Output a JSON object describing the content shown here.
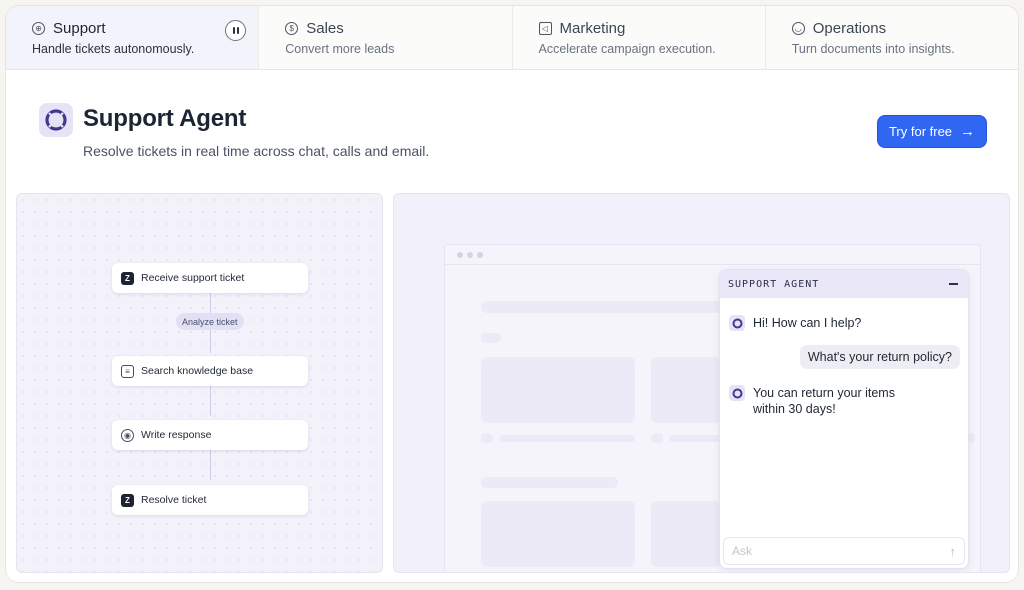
{
  "tabs": [
    {
      "label": "Support",
      "description": "Handle tickets autonomously.",
      "icon": "lifebuoy-icon",
      "active": true
    },
    {
      "label": "Sales",
      "description": "Convert more leads",
      "icon": "dollar-icon",
      "active": false
    },
    {
      "label": "Marketing",
      "description": "Accelerate campaign execution.",
      "icon": "megaphone-icon",
      "active": false
    },
    {
      "label": "Operations",
      "description": "Turn documents into insights.",
      "icon": "smiley-icon",
      "active": false
    }
  ],
  "header": {
    "title": "Support Agent",
    "subtitle": "Resolve tickets in real time across chat, calls and email.",
    "cta_label": "Try for free",
    "accent": "#2f66f2"
  },
  "workflow": {
    "steps": [
      {
        "label": "Receive support ticket",
        "icon": "zendesk-icon"
      },
      {
        "label": "Search knowledge base",
        "icon": "book-icon"
      },
      {
        "label": "Write response",
        "icon": "shield-icon"
      },
      {
        "label": "Resolve ticket",
        "icon": "zendesk-icon"
      }
    ],
    "analyze_label": "Analyze ticket"
  },
  "chat": {
    "title": "SUPPORT AGENT",
    "bot_greeting": "Hi! How can I help?",
    "user_message": "What's your return policy?",
    "bot_reply_line1": "You can return your items",
    "bot_reply_line2": "within 30 days!",
    "input_placeholder": "Ask"
  }
}
